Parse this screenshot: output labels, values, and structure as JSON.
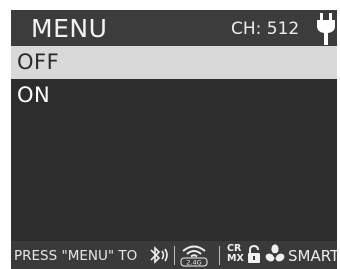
{
  "header": {
    "title": "MENU",
    "channel": "CH: 512",
    "power_icon": "plug-icon"
  },
  "menu": {
    "items": [
      {
        "label": "OFF",
        "selected": true
      },
      {
        "label": "ON",
        "selected": false
      }
    ]
  },
  "footer": {
    "hint": "PRESS \"MENU\" TO",
    "icons": [
      "bluetooth-icon",
      "wifi-2.4g-icon",
      "crmx-icon",
      "lock-icon",
      "fan-icon"
    ],
    "wifi_band": "2.4G",
    "crmx_line1": "CR",
    "crmx_line2": "MX",
    "mode": "SMART"
  },
  "colors": {
    "background": "#2d2d2d",
    "header": "#3c3c3c",
    "selected_row": "#d9d9d9",
    "footer": "#3a3a3a"
  }
}
